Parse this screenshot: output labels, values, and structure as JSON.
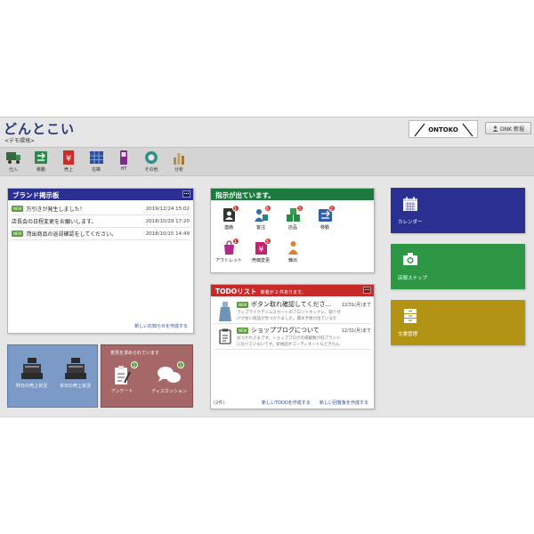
{
  "header": {
    "title": "どんとこい",
    "subtitle": "<デモ環境>",
    "logo_text": "ONTOKO",
    "user_button": "DNK 新堀"
  },
  "toolbar": [
    {
      "label": "仕入",
      "icon": "truck-icon"
    },
    {
      "label": "移動",
      "icon": "transfer-icon"
    },
    {
      "label": "売上",
      "icon": "yen-sales-icon"
    },
    {
      "label": "在庫",
      "icon": "inventory-grid-icon"
    },
    {
      "label": "HT",
      "icon": "handheld-terminal-icon"
    },
    {
      "label": "その他",
      "icon": "circle-other-icon"
    },
    {
      "label": "分析",
      "icon": "bar-analysis-icon"
    }
  ],
  "brand_board": {
    "title": "ブランド掲示板",
    "badge_text": "NEW",
    "rows": [
      {
        "new": true,
        "text": "万引きが発生しました！",
        "date": "2019/12/24 15:02"
      },
      {
        "new": false,
        "text": "店長会の日程変更をお願いします。",
        "date": "2018/10/29 17:20"
      },
      {
        "new": true,
        "text": "貸出商品の返却確認をしてください。",
        "date": "2018/10/15 14:49"
      }
    ],
    "footer_link": "新しいお知らせを作成する"
  },
  "sales_status": {
    "yesterday": "昨日の売上状況",
    "today": "本日の売上状況"
  },
  "opinions": {
    "title": "意見を求められています",
    "items": [
      {
        "label": "アンケート",
        "badge": "1"
      },
      {
        "label": "ディスカッション",
        "badge": "1"
      }
    ]
  },
  "instructions": {
    "title": "指示が出ています。",
    "items": [
      {
        "label": "連絡",
        "badge": "1",
        "icon": "contact-icon"
      },
      {
        "label": "客注",
        "badge": "6",
        "icon": "customer-order-icon"
      },
      {
        "label": "店品",
        "badge": "3",
        "icon": "store-goods-icon"
      },
      {
        "label": "移動",
        "badge": "2",
        "icon": "move-icon"
      },
      {
        "label": "アウトレット",
        "badge": "1",
        "icon": "outlet-icon"
      },
      {
        "label": "売価変更",
        "badge": "5",
        "icon": "price-change-icon"
      },
      {
        "label": "錬出",
        "badge": "",
        "icon": "dispatch-icon"
      }
    ]
  },
  "todo": {
    "title": "TODOリスト",
    "subtitle": "新着が 2 件あります。",
    "items": [
      {
        "title": "ボタン取れ確認してくださ...",
        "date": "12/31(月)まで",
        "desc1": "ラップライクデニムスカートのフロントホックに、取り付",
        "desc2": "けが甘い商品が見つかりました。漏水予想が出ているた"
      },
      {
        "title": "ショップブログについて",
        "date": "12/31(月)まで",
        "desc1": "おつかれさまです。ショップブログの掲載数が低ブランド",
        "desc2": "に比べて少ないです。新規品やコーディネートなどきちん"
      }
    ],
    "count": "(2件)",
    "link1": "新しいTODOを作成する",
    "link2": "新しい回覧板を作成する"
  },
  "tiles": [
    {
      "label": "カレンダー",
      "color": "#2b2f92"
    },
    {
      "label": "店頭スナップ",
      "color": "#2e9746"
    },
    {
      "label": "文書管理",
      "color": "#b39314"
    }
  ],
  "colors": {
    "navy": "#2b2f92",
    "green": "#1d7a3e",
    "red": "#c82a2a",
    "steel_blue": "#7c9ac6",
    "rose": "#a56767"
  }
}
